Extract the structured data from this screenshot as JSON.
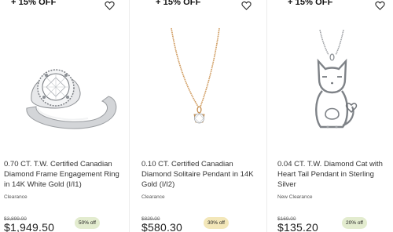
{
  "products": [
    {
      "promo": "+ 15% OFF",
      "image_icon": "diamond-ring-icon",
      "title": "0.70 CT. T.W. Certified Canadian Diamond Frame Engagement Ring in 14K White Gold (I/I1)",
      "tag": "Clearance",
      "was_price": "$3,899.00",
      "price": "$1,949.50",
      "badge": "50% off",
      "badge_color": "#e3eccf"
    },
    {
      "promo": "+ 15% OFF",
      "image_icon": "solitaire-pendant-icon",
      "title": "0.10 CT. Certified Canadian Diamond Solitaire Pendant in 14K Gold (I/I2)",
      "tag": "Clearance",
      "was_price": "$829.00",
      "price": "$580.30",
      "badge": "30% off",
      "badge_color": "#f3e7b9"
    },
    {
      "promo": "+ 15% OFF",
      "image_icon": "cat-pendant-icon",
      "title": "0.04 CT. T.W. Diamond Cat with Heart Tail Pendant in Sterling Silver",
      "tag": "New Clearance",
      "was_price": "$169.00",
      "price": "$135.20",
      "badge": "20% off",
      "badge_color": "#e3eccf"
    }
  ]
}
